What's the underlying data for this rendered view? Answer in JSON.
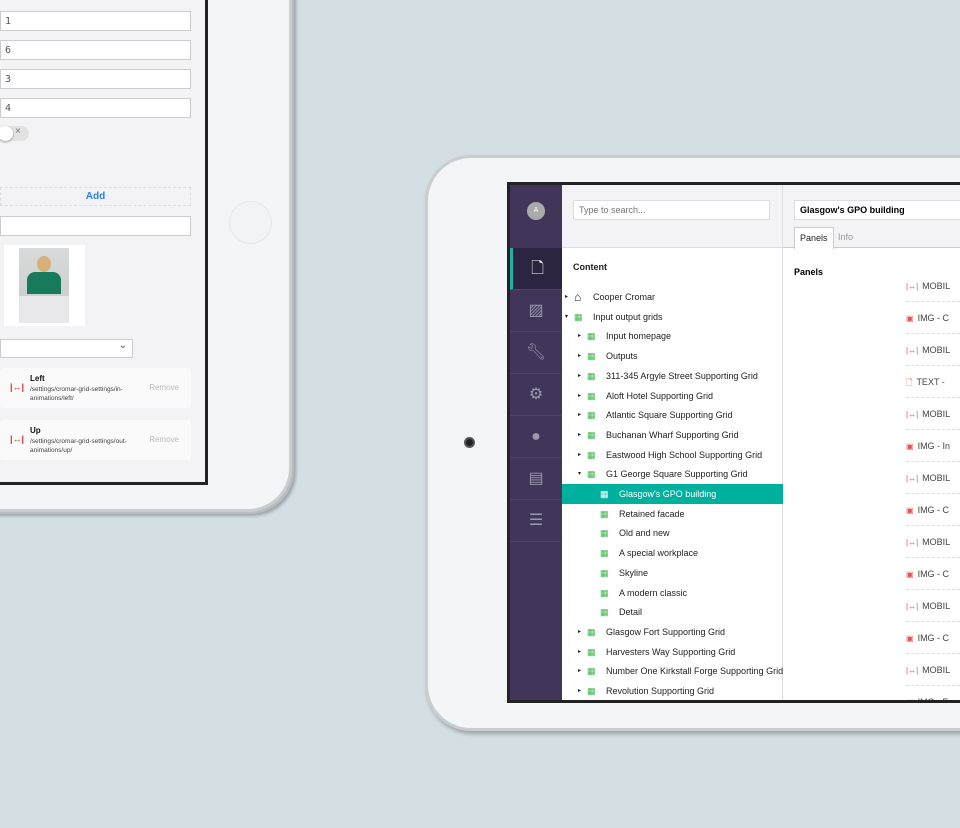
{
  "left_tablet": {
    "inputs": [
      "1",
      "6",
      "3",
      "4"
    ],
    "toggle": {
      "on": false,
      "off_icon": "×"
    },
    "add_label": "Add",
    "empty_input": "",
    "select_value": "",
    "animations": [
      {
        "title": "Left",
        "path": "/settings/cromar-grid-settings/in-animations/left/",
        "remove": "Remove",
        "icon": "arrows-horizontal-icon"
      },
      {
        "title": "Up",
        "path": "/settings/cromar-grid-settings/out-animations/up/",
        "remove": "Remove",
        "icon": "arrows-horizontal-icon"
      }
    ]
  },
  "sidebar": {
    "avatar": "A",
    "items": [
      "document",
      "image",
      "wrench",
      "gear",
      "user",
      "contact-card",
      "server"
    ],
    "active": "document",
    "accent": "#1fb29e"
  },
  "tree": {
    "search_placeholder": "Type to search...",
    "heading": "Content",
    "items": [
      {
        "label": "Cooper Cromar",
        "level": 0,
        "icon": "home",
        "arrow": "▸"
      },
      {
        "label": "Input output grids",
        "level": 0,
        "icon": "grid",
        "arrow": "▾"
      },
      {
        "label": "Input homepage",
        "level": 1,
        "icon": "grid",
        "arrow": "▸"
      },
      {
        "label": "Outputs",
        "level": 1,
        "icon": "grid",
        "arrow": "▸"
      },
      {
        "label": "311-345 Argyle Street Supporting Grid",
        "level": 1,
        "icon": "grid",
        "arrow": "▸"
      },
      {
        "label": "Aloft Hotel Supporting Grid",
        "level": 1,
        "icon": "grid",
        "arrow": "▸"
      },
      {
        "label": "Atlantic Square Supporting Grid",
        "level": 1,
        "icon": "grid",
        "arrow": "▸"
      },
      {
        "label": "Buchanan Wharf Supporting Grid",
        "level": 1,
        "icon": "grid",
        "arrow": "▸"
      },
      {
        "label": "Eastwood High School Supporting Grid",
        "level": 1,
        "icon": "grid",
        "arrow": "▸"
      },
      {
        "label": "G1 George Square Supporting Grid",
        "level": 1,
        "icon": "grid",
        "arrow": "▾"
      },
      {
        "label": "Glasgow's GPO building",
        "level": 2,
        "icon": "grid",
        "arrow": "",
        "selected": true
      },
      {
        "label": "Retained facade",
        "level": 2,
        "icon": "grid",
        "arrow": ""
      },
      {
        "label": "Old and new",
        "level": 2,
        "icon": "grid",
        "arrow": ""
      },
      {
        "label": "A special workplace",
        "level": 2,
        "icon": "grid",
        "arrow": ""
      },
      {
        "label": "Skyline",
        "level": 2,
        "icon": "grid",
        "arrow": ""
      },
      {
        "label": "A modern classic",
        "level": 2,
        "icon": "grid",
        "arrow": ""
      },
      {
        "label": "Detail",
        "level": 2,
        "icon": "grid",
        "arrow": ""
      },
      {
        "label": "Glasgow Fort Supporting Grid",
        "level": 1,
        "icon": "grid",
        "arrow": "▸"
      },
      {
        "label": "Harvesters Way Supporting Grid",
        "level": 1,
        "icon": "grid",
        "arrow": "▸"
      },
      {
        "label": "Number One Kirkstall Forge Supporting Grid",
        "level": 1,
        "icon": "grid",
        "arrow": "▸"
      },
      {
        "label": "Revolution Supporting Grid",
        "level": 1,
        "icon": "grid",
        "arrow": "▸"
      }
    ],
    "selected_color": "#00b09e"
  },
  "editor": {
    "name": "Glasgow's GPO building",
    "tabs": [
      "Panels",
      "Info"
    ],
    "active_tab": "Panels",
    "section_label": "Panels",
    "panels": [
      {
        "label": "MOBIL",
        "icon": "arrows"
      },
      {
        "label": "IMG - C",
        "icon": "image"
      },
      {
        "label": "MOBIL",
        "icon": "arrows"
      },
      {
        "label": "TEXT -",
        "icon": "document"
      },
      {
        "label": "MOBIL",
        "icon": "arrows"
      },
      {
        "label": "IMG - In",
        "icon": "image"
      },
      {
        "label": "MOBIL",
        "icon": "arrows"
      },
      {
        "label": "IMG - C",
        "icon": "image"
      },
      {
        "label": "MOBIL",
        "icon": "arrows"
      },
      {
        "label": "IMG - C",
        "icon": "image"
      },
      {
        "label": "MOBIL",
        "icon": "arrows"
      },
      {
        "label": "IMG - C",
        "icon": "image"
      },
      {
        "label": "MOBIL",
        "icon": "arrows"
      },
      {
        "label": "IMG - F",
        "icon": "image"
      }
    ]
  }
}
